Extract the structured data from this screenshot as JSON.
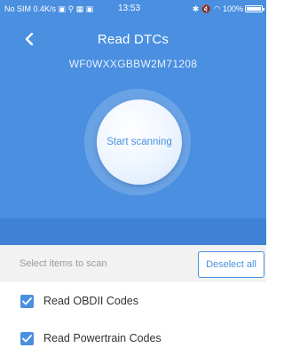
{
  "status_bar": {
    "left": "No SIM 0.4K/s",
    "time": "13:53",
    "battery": "100%"
  },
  "header": {
    "title": "Read DTCs",
    "vin": "WF0WXXGBBW2M71208"
  },
  "scan": {
    "button_label": "Start scanning"
  },
  "toolbar": {
    "label": "Select items to scan",
    "deselect_label": "Deselect all"
  },
  "options": [
    {
      "label": "Read OBDII Codes",
      "checked": true
    },
    {
      "label": "Read Powertrain Codes",
      "checked": true
    }
  ],
  "colors": {
    "accent": "#4a8fe0",
    "toolbar_bg": "#f2f2f2"
  }
}
